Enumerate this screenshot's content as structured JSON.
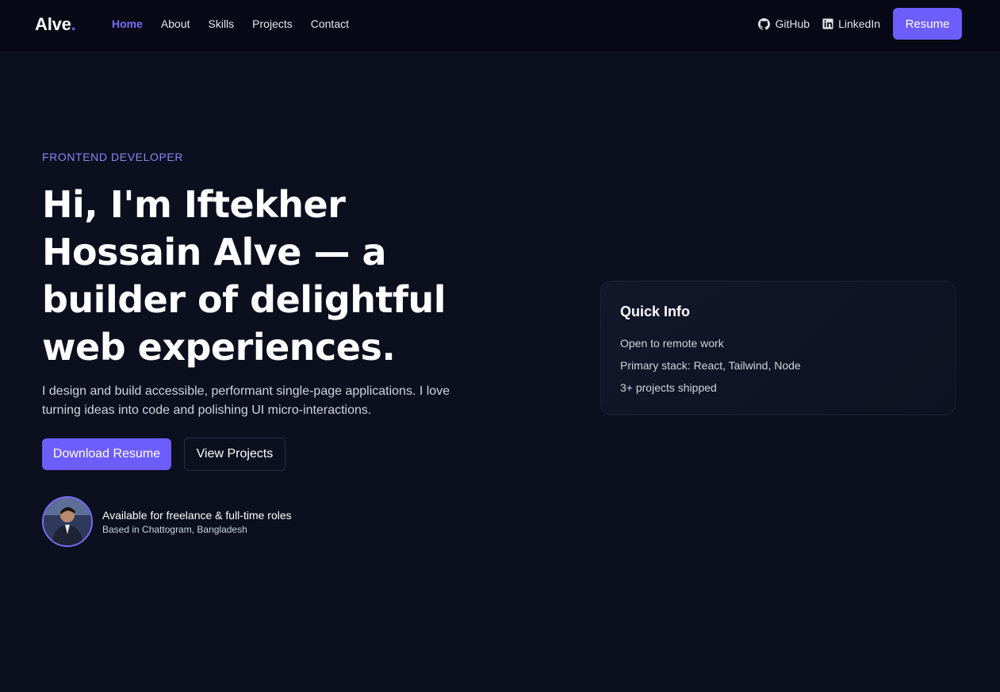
{
  "brand": {
    "name": "Alve",
    "dot": "."
  },
  "nav": {
    "links": [
      "Home",
      "About",
      "Skills",
      "Projects",
      "Contact"
    ],
    "active": "Home",
    "social": [
      {
        "label": "GitHub",
        "icon": "github-icon"
      },
      {
        "label": "LinkedIn",
        "icon": "linkedin-icon"
      }
    ],
    "resume_label": "Resume"
  },
  "hero": {
    "eyebrow": "FRONTEND DEVELOPER",
    "headline": "Hi, I'm Iftekher Hossain Alve — a builder of delightful web experiences.",
    "lead": "I design and build accessible, performant single-page applications. I love turning ideas into code and polishing UI micro-interactions.",
    "primary_cta": "Download Resume",
    "secondary_cta": "View Projects",
    "availability": {
      "title": "Available for freelance & full-time roles",
      "location": "Based in Chattogram, Bangladesh"
    }
  },
  "quick_info": {
    "title": "Quick Info",
    "items": [
      "Open to remote work",
      "Primary stack: React, Tailwind, Node",
      "3+ projects shipped"
    ]
  },
  "colors": {
    "accent": "#6d5efc",
    "background": "#0b0f1e",
    "nav_background": "#070a16"
  }
}
